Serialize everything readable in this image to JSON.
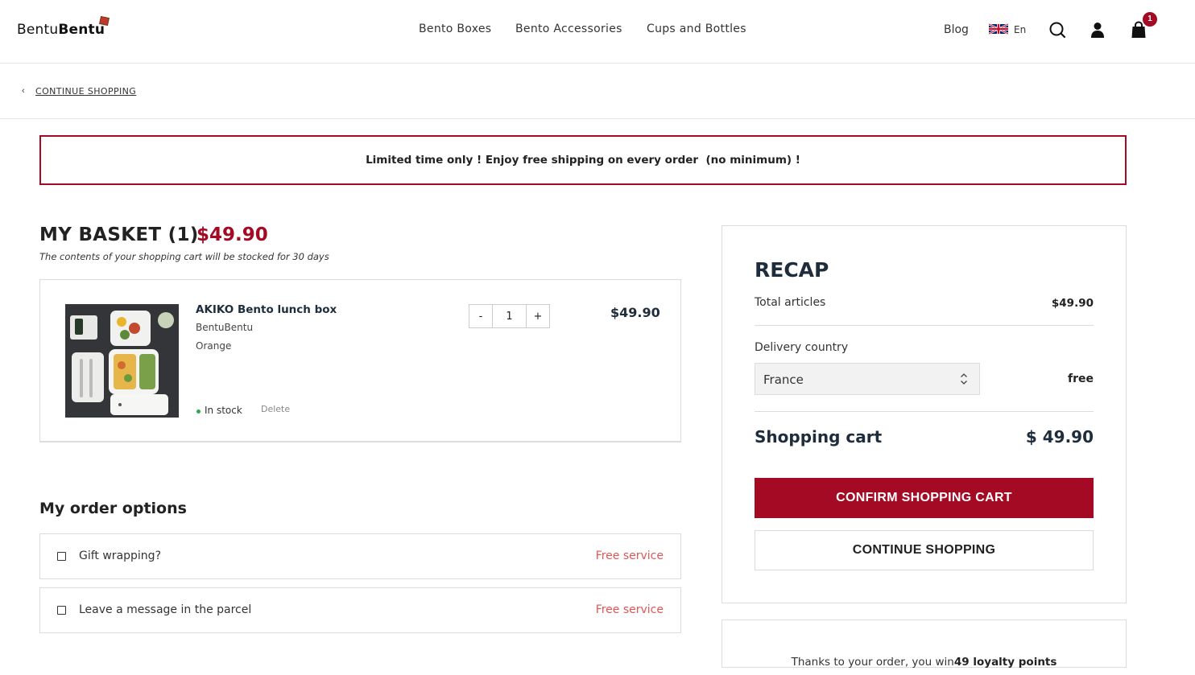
{
  "header": {
    "logo_part1": "Bentu",
    "logo_part2": "Bentu",
    "nav": [
      "Bento Boxes",
      "Bento Accessories",
      "Cups and Bottles"
    ],
    "blog": "Blog",
    "lang": "En",
    "cart_count": "1",
    "icons": [
      "search-icon",
      "user-icon",
      "bag-icon",
      "flag-uk-icon"
    ]
  },
  "continue_link": "CONTINUE SHOPPING",
  "banner": "Limited time only ! Enjoy free shipping on every order  (no minimum) !",
  "basket": {
    "title": "MY BASKET (1)",
    "total": "$49.90",
    "note": "The contents of your shopping cart will be stocked for 30 days",
    "item": {
      "name": "AKIKO Bento lunch box",
      "brand": "BentuBentu",
      "color": "Orange",
      "stock": "In stock",
      "delete": "Delete",
      "qty_minus": "-",
      "qty": "1",
      "qty_plus": "+",
      "price": "$49.90"
    }
  },
  "options": {
    "title": "My order options",
    "items": [
      {
        "label": "Gift wrapping?",
        "price": "Free service"
      },
      {
        "label": "Leave a message in the parcel",
        "price": "Free service"
      }
    ]
  },
  "recap": {
    "title": "RECAP",
    "total_articles_label": "Total articles",
    "total_articles_value": "$49.90",
    "delivery_label": "Delivery country",
    "country": "France",
    "delivery_value": "free",
    "cart_label": "Shopping cart",
    "cart_value": "$ 49.90",
    "confirm": "CONFIRM SHOPPING CART",
    "continue": "CONTINUE SHOPPING"
  },
  "loyalty": {
    "prefix": "Thanks to your order, you win ",
    "points": "49 loyalty points"
  },
  "colors": {
    "accent": "#a50a24",
    "dark_text": "#1e2d3b",
    "free_service": "#e05555",
    "in_stock": "#2eaa4a"
  }
}
